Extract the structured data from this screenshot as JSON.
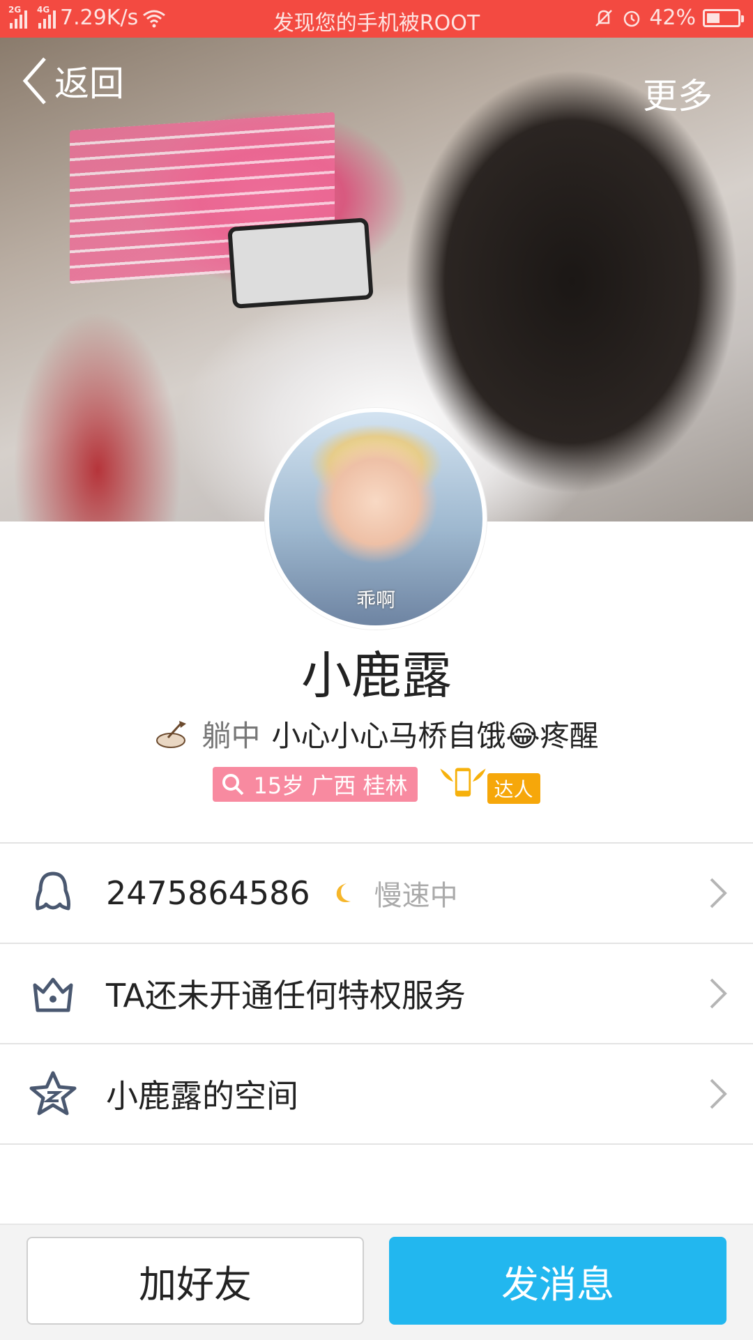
{
  "status_bar": {
    "sim1": "2G",
    "sim2": "4G",
    "speed": "7.29K/s",
    "notice": "发现您的手机被ROOT",
    "battery_pct": "42%",
    "battery_level": 0.42
  },
  "nav": {
    "back_label": "返回",
    "more_label": "更多"
  },
  "profile": {
    "avatar_caption": "乖啊",
    "name": "小鹿露",
    "status": "躺中",
    "signature": "小心小心马桥自饿😂疼醒",
    "info_tag": "15岁  广西  桂林",
    "expert_label": "达人"
  },
  "list": {
    "qq_number": "2475864586",
    "qq_speed": "慢速中",
    "privilege": "TA还未开通任何特权服务",
    "space": "小鹿露的空间"
  },
  "actions": {
    "add_friend": "加好友",
    "send_message": "发消息"
  },
  "colors": {
    "status_bar": "#f34a41",
    "primary_button": "#22b7ef",
    "info_tag": "#f88aa0",
    "expert_badge": "#f6a70a"
  }
}
